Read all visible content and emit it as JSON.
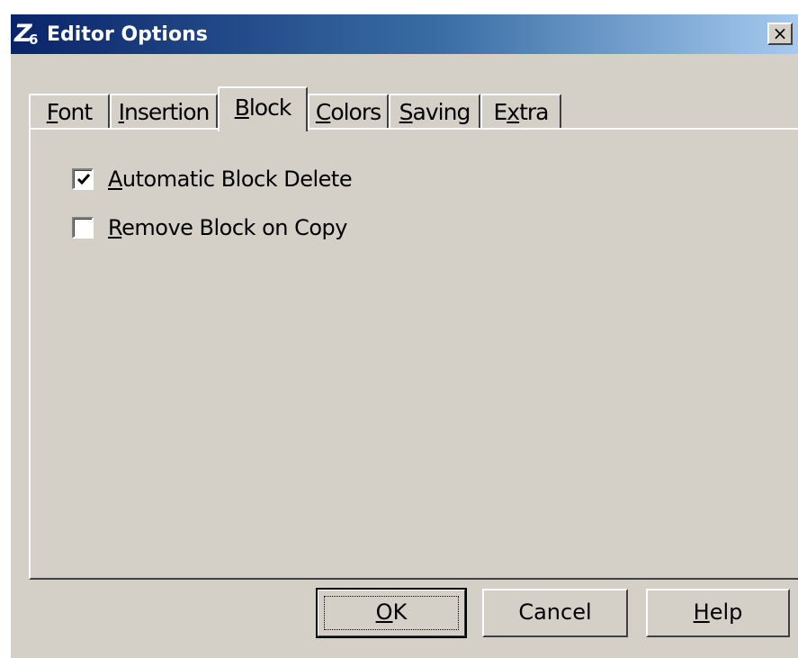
{
  "window": {
    "title": "Editor Options",
    "icon": {
      "glyph_main": "Z",
      "glyph_sub": "6",
      "name": "app-icon"
    },
    "close_glyph": "×"
  },
  "tabs": [
    {
      "pre": "",
      "mnemonic": "F",
      "post": "ont",
      "active": false
    },
    {
      "pre": "",
      "mnemonic": "I",
      "post": "nsertion",
      "active": false
    },
    {
      "pre": "",
      "mnemonic": "B",
      "post": "lock",
      "active": true
    },
    {
      "pre": "",
      "mnemonic": "C",
      "post": "olors",
      "active": false
    },
    {
      "pre": "",
      "mnemonic": "S",
      "post": "aving",
      "active": false
    },
    {
      "pre": "E",
      "mnemonic": "x",
      "post": "tra",
      "active": false
    }
  ],
  "options": [
    {
      "pre": "",
      "mnemonic": "A",
      "post": "utomatic Block Delete",
      "checked": true
    },
    {
      "pre": "",
      "mnemonic": "R",
      "post": "emove Block on Copy",
      "checked": false
    }
  ],
  "buttons": {
    "ok": {
      "pre": "",
      "mnemonic": "O",
      "post": "K"
    },
    "cancel": {
      "label": "Cancel"
    },
    "help": {
      "pre": "",
      "mnemonic": "H",
      "post": "elp"
    }
  },
  "colors": {
    "face": "#d4d0c8",
    "title_start": "#0a246a",
    "title_end": "#a6caf0"
  }
}
